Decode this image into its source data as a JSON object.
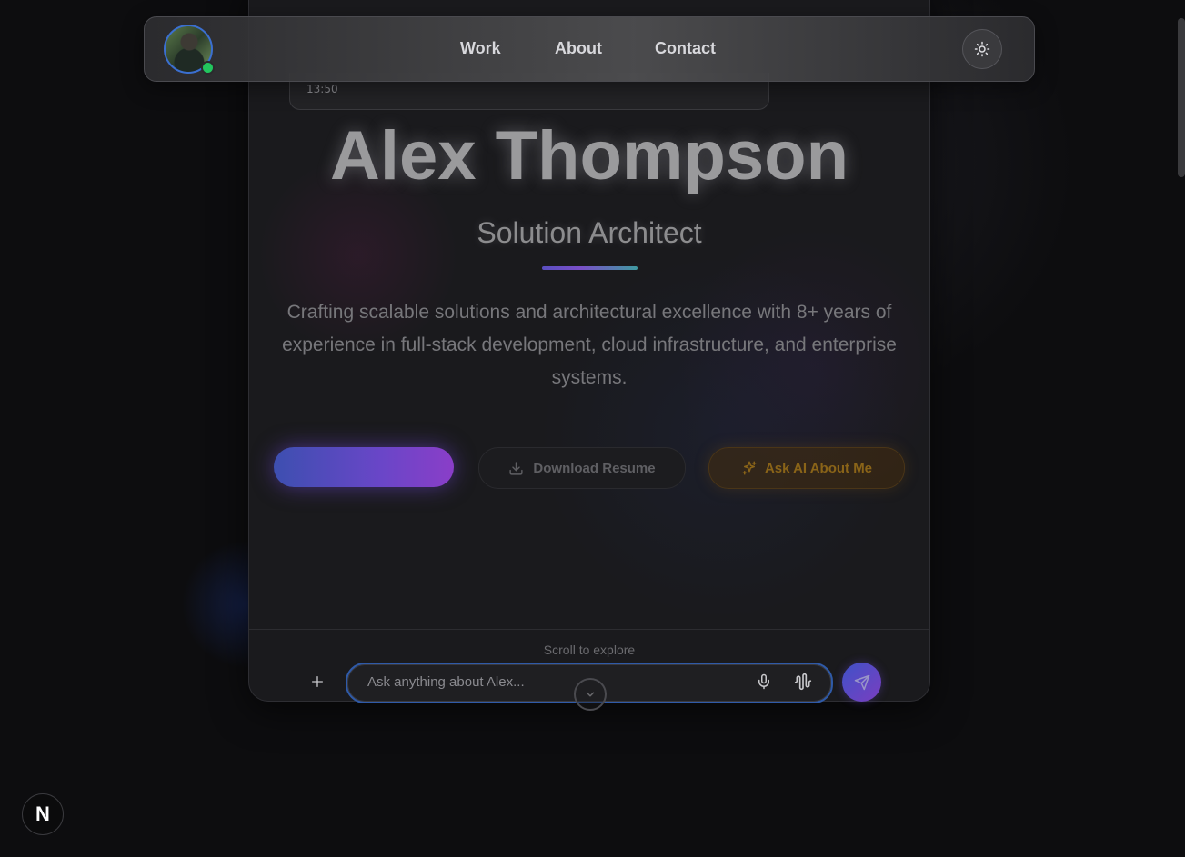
{
  "nav": {
    "links": [
      {
        "label": "Work"
      },
      {
        "label": "About"
      },
      {
        "label": "Contact"
      }
    ]
  },
  "message": {
    "time": "13:50"
  },
  "hero": {
    "name": "Alex Thompson",
    "role": "Solution Architect",
    "description": "Crafting scalable solutions and architectural excellence with 8+ years of experience in full-stack development, cloud infrastructure, and enterprise systems.",
    "download_label": "Download Resume",
    "ask_ai_label": "Ask AI About Me"
  },
  "scroll_hint": "Scroll to explore",
  "chat": {
    "placeholder": "Ask anything about Alex..."
  },
  "badge": {
    "letter": "N"
  },
  "colors": {
    "accent_blue": "#3d4fb0",
    "accent_purple": "#8a3ec8",
    "online": "#22c55e",
    "ai_gold": "#8a6418"
  }
}
